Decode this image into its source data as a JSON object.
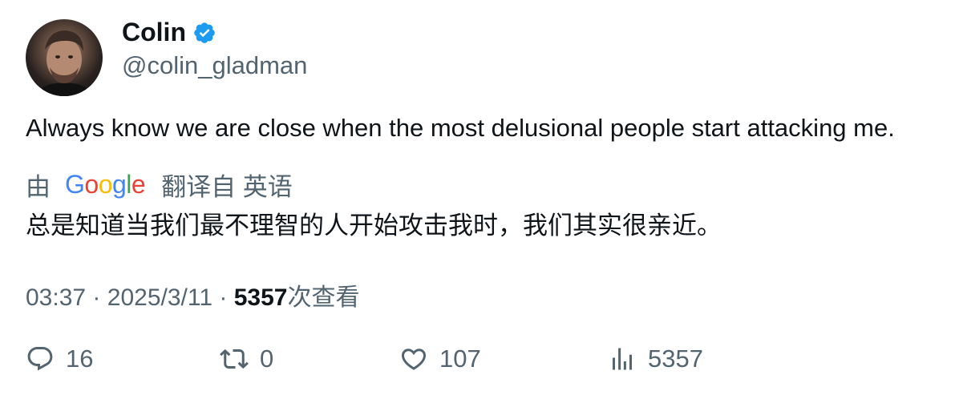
{
  "author": {
    "display_name": "Colin",
    "handle": "@colin_gladman",
    "verified_color": "#1d9bf0"
  },
  "tweet": {
    "text": "Always know we are close when the most delusional people start attacking me.",
    "translation": {
      "by_label": "由",
      "provider": "Google",
      "from_label": "翻译自 英语",
      "text": "总是知道当我们最不理智的人开始攻击我时，我们其实很亲近。"
    },
    "meta": {
      "time": "03:37",
      "sep1": "·",
      "date": "2025/3/11",
      "sep2": "·",
      "views_count": "5357",
      "views_suffix": "次查看"
    }
  },
  "actions": {
    "replies": "16",
    "retweets": "0",
    "likes": "107",
    "views": "5357"
  },
  "colors": {
    "text_primary": "#0f1419",
    "text_secondary": "#536471",
    "google_blue": "#4285F4",
    "google_red": "#EA4335",
    "google_yellow": "#FBBC05",
    "google_green": "#34A853"
  },
  "icons": [
    "verified-badge-icon",
    "reply-icon",
    "retweet-icon",
    "like-icon",
    "views-icon"
  ]
}
